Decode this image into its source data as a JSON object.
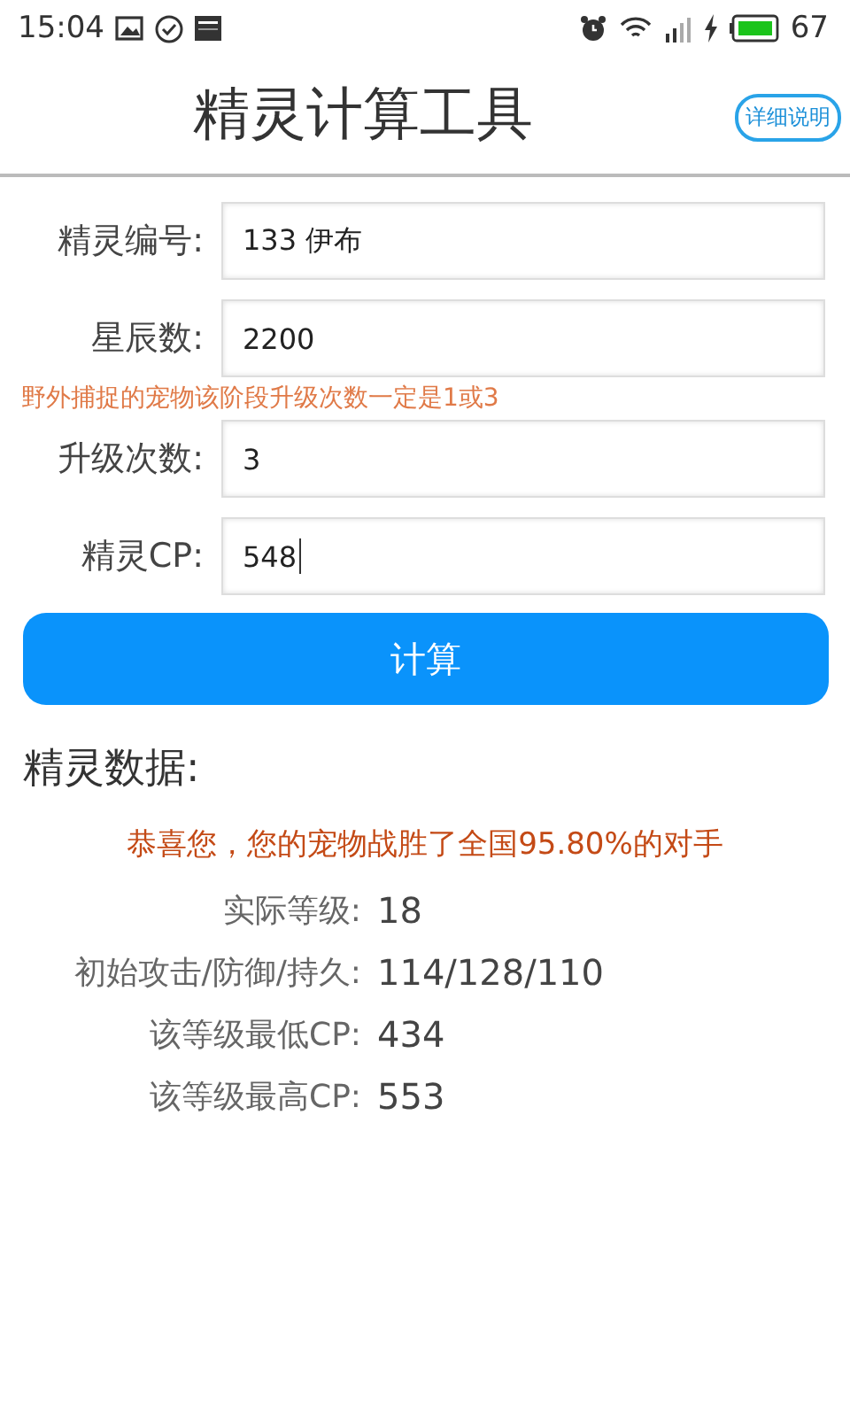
{
  "status_bar": {
    "time": "15:04",
    "battery": "67"
  },
  "header": {
    "title": "精灵计算工具",
    "help_button": "详细说明"
  },
  "form": [
    {
      "kind": "field",
      "label": "精灵编号:",
      "value": "133 伊布",
      "focused": false
    },
    {
      "kind": "field",
      "label": "星辰数:",
      "value": "2200",
      "focused": false
    },
    {
      "kind": "hint",
      "text": "野外捕捉的宠物该阶段升级次数一定是1或3"
    },
    {
      "kind": "field",
      "label": "升级次数:",
      "value": "3",
      "focused": false
    },
    {
      "kind": "field",
      "label": "精灵CP:",
      "value": "548",
      "focused": true
    }
  ],
  "calculate_button": "计算",
  "results": {
    "title": "精灵数据:",
    "message": "恭喜您，您的宠物战胜了全国95.80%的对手",
    "rows": [
      {
        "label": "实际等级:",
        "value": "18"
      },
      {
        "label": "初始攻击/防御/持久:",
        "value": "114/128/110"
      },
      {
        "label": "该等级最低CP:",
        "value": "434"
      },
      {
        "label": "该等级最高CP:",
        "value": "553"
      }
    ]
  }
}
